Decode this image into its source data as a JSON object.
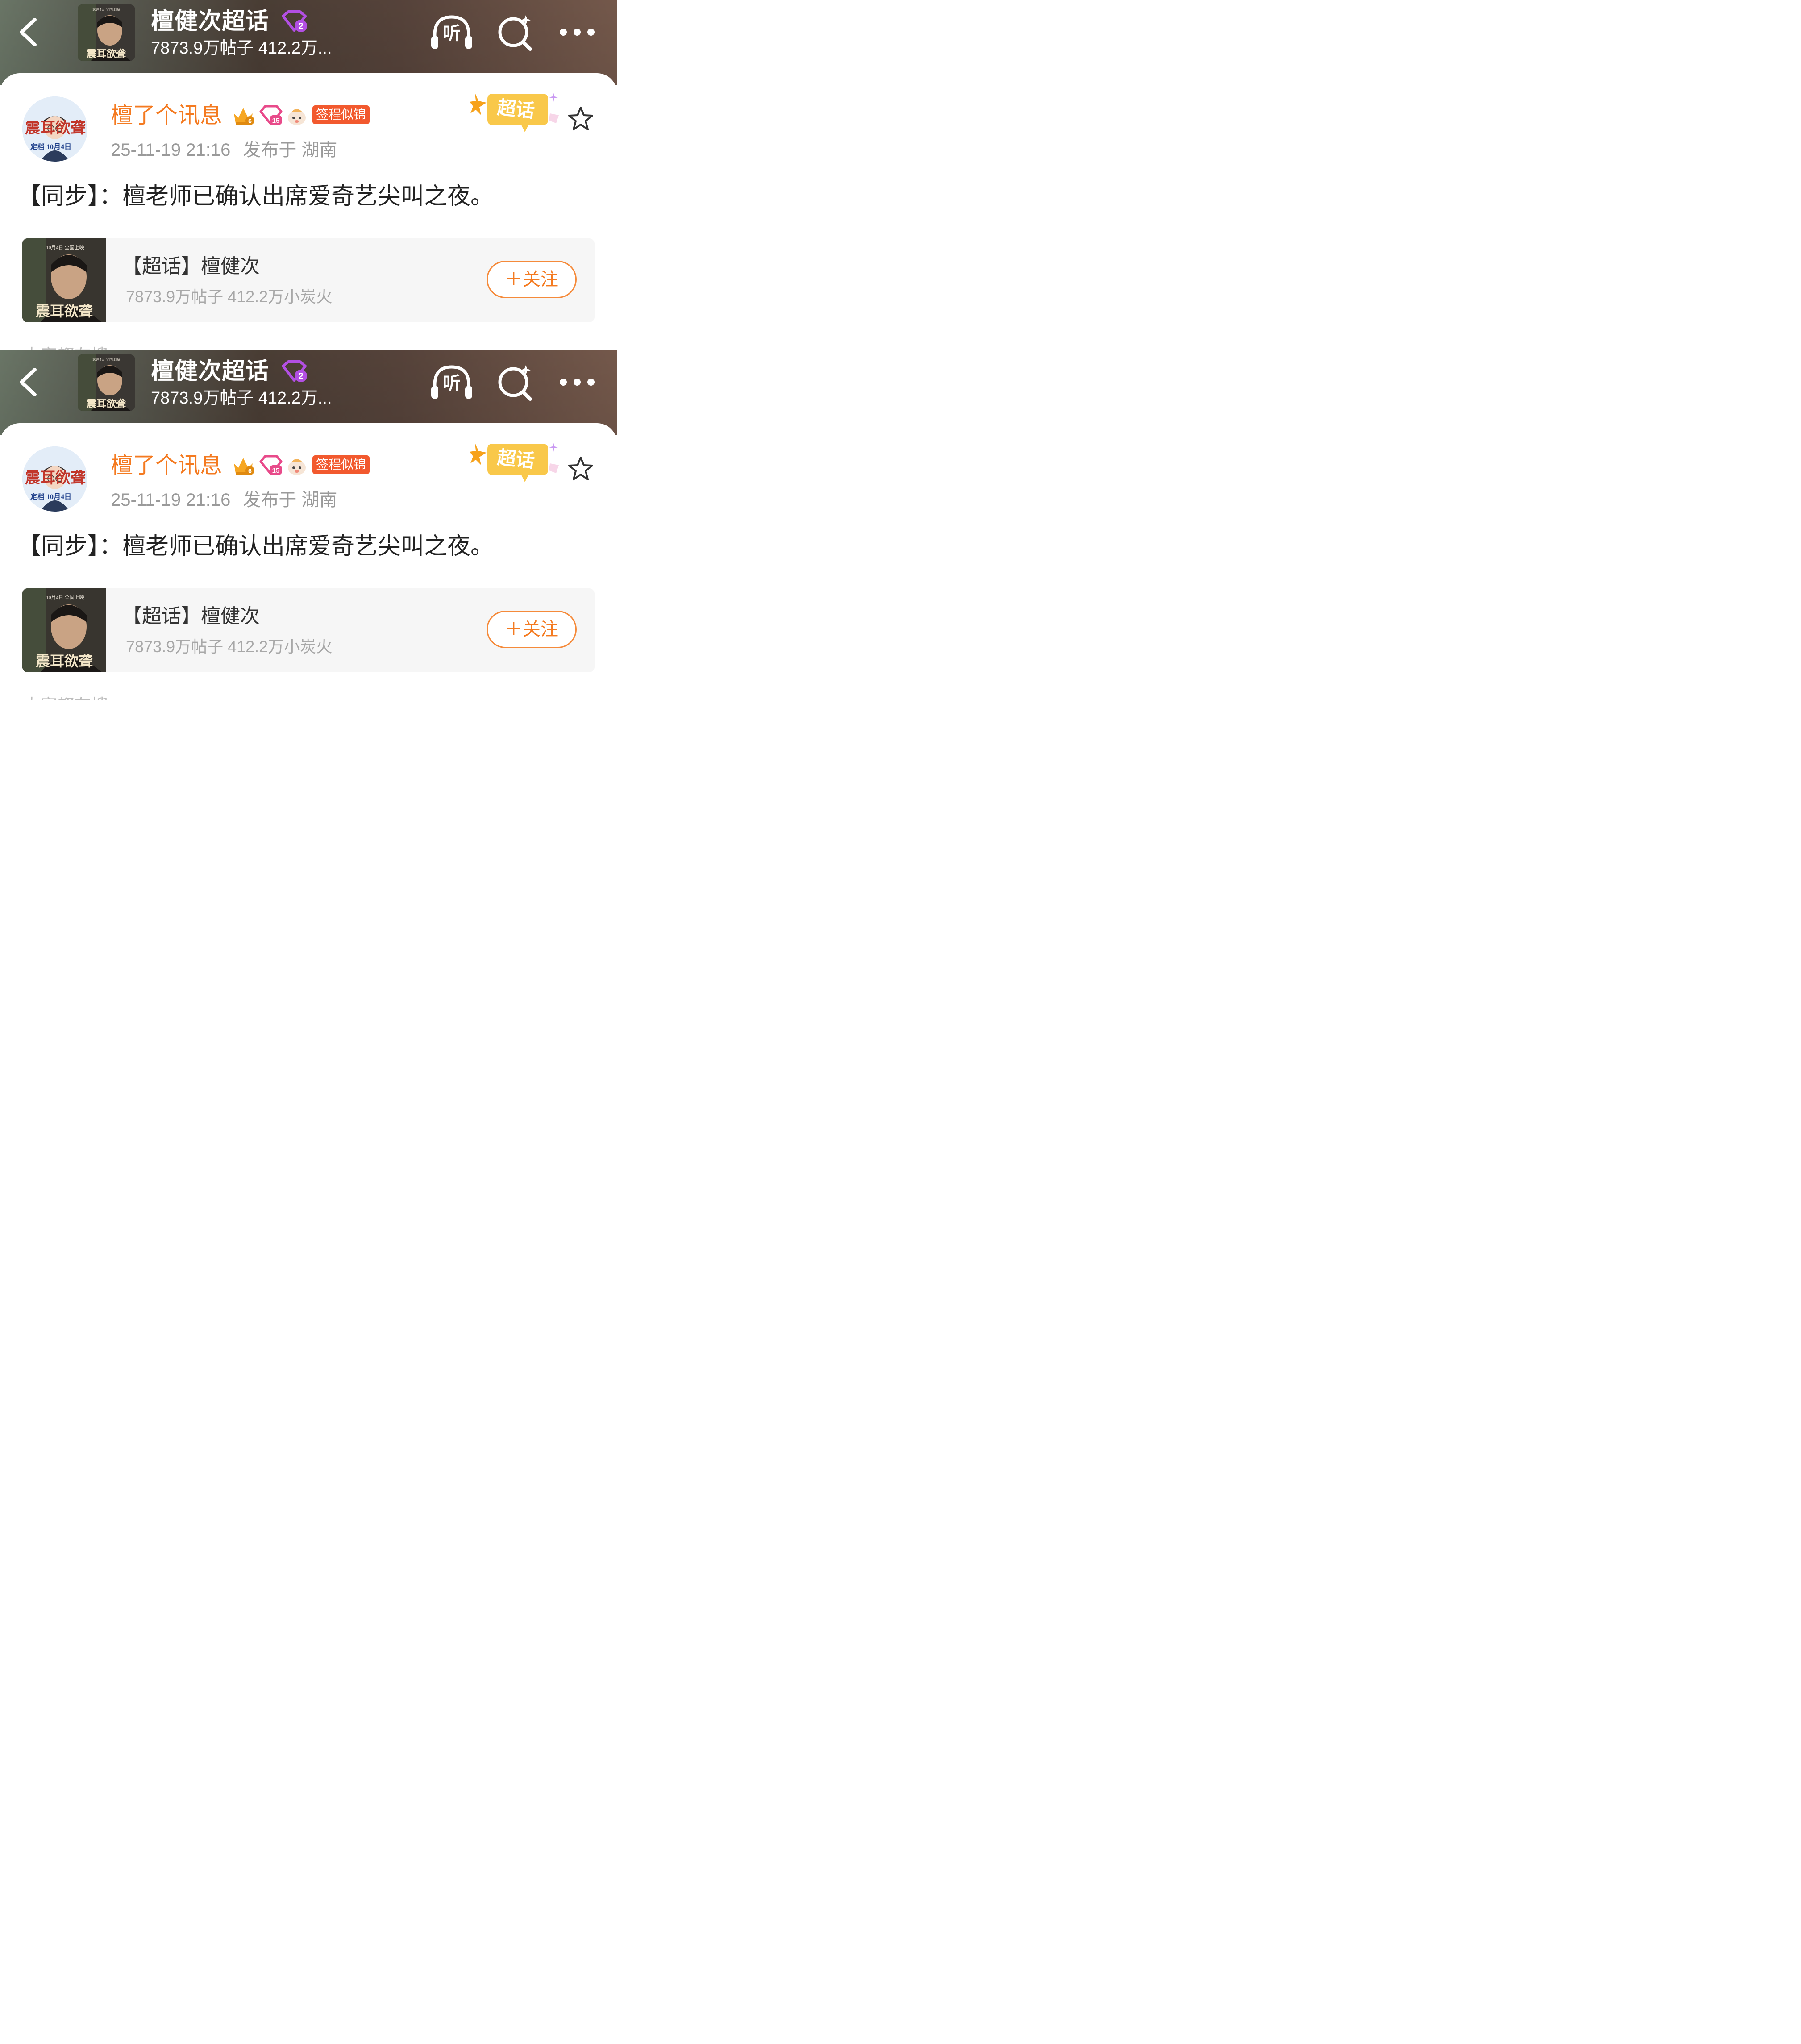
{
  "header": {
    "title": "檀健次超话",
    "stats": "7873.9万帖子 412.2万...",
    "listen_label": "听",
    "thumb_poster_text": "震耳欲聋",
    "thumb_release_text": "10月4日 全国上映",
    "level_badge": "2"
  },
  "post": {
    "author_name": "檀了个讯息",
    "crown_level": "6",
    "diamond_level": "15",
    "fan_badge": "签程似锦",
    "timestamp": "25-11-19 21:16",
    "location": "发布于 湖南",
    "supertopic_badge": "超话",
    "avatar_poster_text": "震耳欲聋",
    "avatar_date_text": "定档 10月4日",
    "text": "【同步】：檀老师已确认出席爱奇艺尖叫之夜。"
  },
  "topic_card": {
    "name": "【超话】檀健次",
    "stats": "7873.9万帖子 412.2万小炭火",
    "follow_label": "＋关注",
    "thumb_poster_text": "震耳欲聋",
    "thumb_release_text": "10月4日 全国上映"
  },
  "peek_text": "大家都在搜",
  "colors": {
    "accent_orange": "#f47a20",
    "fan_badge_red": "#f2592e",
    "header_brown": "#4d4037",
    "meta_gray": "#9a9a9a"
  }
}
